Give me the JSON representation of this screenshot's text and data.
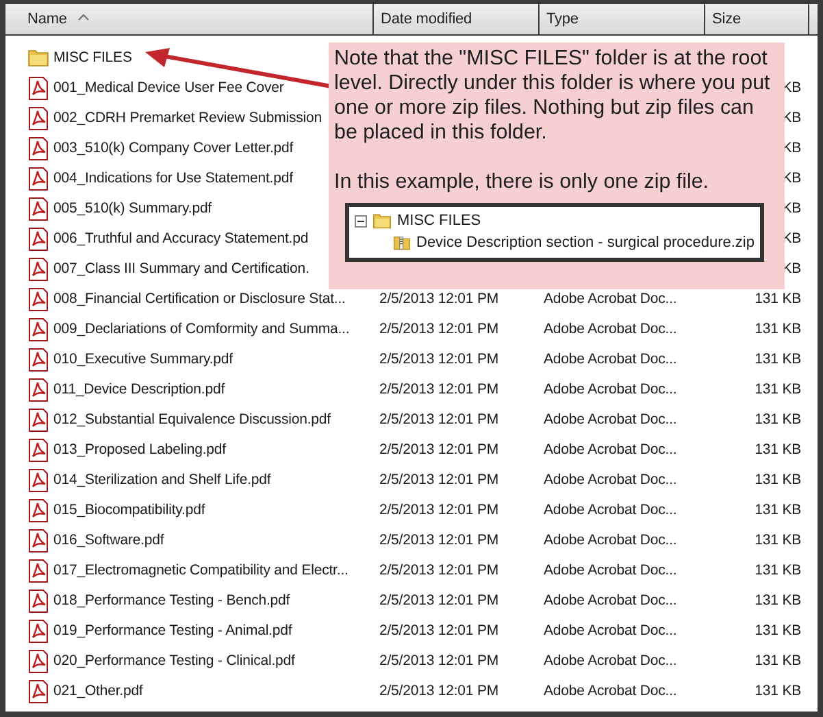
{
  "columns": [
    {
      "label": "Name",
      "sorted": true
    },
    {
      "label": "Date modified",
      "sorted": false
    },
    {
      "label": "Type",
      "sorted": false
    },
    {
      "label": "Size",
      "sorted": false
    }
  ],
  "rows": [
    {
      "kind": "folder",
      "name": "MISC FILES"
    },
    {
      "kind": "pdf",
      "name": "001_Medical Device User Fee Cover",
      "size": "KB"
    },
    {
      "kind": "pdf",
      "name": "002_CDRH Premarket Review Submission",
      "size": "KB"
    },
    {
      "kind": "pdf",
      "name": "003_510(k) Company Cover Letter.pdf",
      "size": "KB"
    },
    {
      "kind": "pdf",
      "name": "004_Indications for Use Statement.pdf",
      "size": "KB"
    },
    {
      "kind": "pdf",
      "name": "005_510(k) Summary.pdf",
      "size": "KB"
    },
    {
      "kind": "pdf",
      "name": "006_Truthful and Accuracy Statement.pd",
      "size": "KB"
    },
    {
      "kind": "pdf",
      "name": "007_Class III Summary and Certification.",
      "size": "KB"
    },
    {
      "kind": "pdf",
      "name": "008_Financial Certification or Disclosure Stat...",
      "date": "2/5/2013 12:01 PM",
      "type": "Adobe Acrobat Doc...",
      "size": "131 KB"
    },
    {
      "kind": "pdf",
      "name": "009_Declariations of Comformity and Summa...",
      "date": "2/5/2013 12:01 PM",
      "type": "Adobe Acrobat Doc...",
      "size": "131 KB"
    },
    {
      "kind": "pdf",
      "name": "010_Executive Summary.pdf",
      "date": "2/5/2013 12:01 PM",
      "type": "Adobe Acrobat Doc...",
      "size": "131 KB"
    },
    {
      "kind": "pdf",
      "name": "011_Device Description.pdf",
      "date": "2/5/2013 12:01 PM",
      "type": "Adobe Acrobat Doc...",
      "size": "131 KB"
    },
    {
      "kind": "pdf",
      "name": "012_Substantial Equivalence Discussion.pdf",
      "date": "2/5/2013 12:01 PM",
      "type": "Adobe Acrobat Doc...",
      "size": "131 KB"
    },
    {
      "kind": "pdf",
      "name": "013_Proposed Labeling.pdf",
      "date": "2/5/2013 12:01 PM",
      "type": "Adobe Acrobat Doc...",
      "size": "131 KB"
    },
    {
      "kind": "pdf",
      "name": "014_Sterilization and Shelf Life.pdf",
      "date": "2/5/2013 12:01 PM",
      "type": "Adobe Acrobat Doc...",
      "size": "131 KB"
    },
    {
      "kind": "pdf",
      "name": "015_Biocompatibility.pdf",
      "date": "2/5/2013 12:01 PM",
      "type": "Adobe Acrobat Doc...",
      "size": "131 KB"
    },
    {
      "kind": "pdf",
      "name": "016_Software.pdf",
      "date": "2/5/2013 12:01 PM",
      "type": "Adobe Acrobat Doc...",
      "size": "131 KB"
    },
    {
      "kind": "pdf",
      "name": "017_Electromagnetic Compatibility and Electr...",
      "date": "2/5/2013 12:01 PM",
      "type": "Adobe Acrobat Doc...",
      "size": "131 KB"
    },
    {
      "kind": "pdf",
      "name": "018_Performance Testing - Bench.pdf",
      "date": "2/5/2013 12:01 PM",
      "type": "Adobe Acrobat Doc...",
      "size": "131 KB"
    },
    {
      "kind": "pdf",
      "name": "019_Performance Testing - Animal.pdf",
      "date": "2/5/2013 12:01 PM",
      "type": "Adobe Acrobat Doc...",
      "size": "131 KB"
    },
    {
      "kind": "pdf",
      "name": "020_Performance Testing - Clinical.pdf",
      "date": "2/5/2013 12:01 PM",
      "type": "Adobe Acrobat Doc...",
      "size": "131 KB"
    },
    {
      "kind": "pdf",
      "name": "021_Other.pdf",
      "date": "2/5/2013 12:01 PM",
      "type": "Adobe Acrobat Doc...",
      "size": "131 KB"
    }
  ],
  "callout": {
    "note": "Note that the \"MISC FILES\" folder is at the root level.  Directly under this folder is where you put one or more zip files.  Nothing but zip files can be placed in this folder.",
    "example": "In this example, there is only one zip file.",
    "tree": {
      "label": "MISC FILES",
      "expanded": true,
      "children": [
        {
          "label": "Device Description section - surgical procedure.zip"
        }
      ]
    }
  }
}
